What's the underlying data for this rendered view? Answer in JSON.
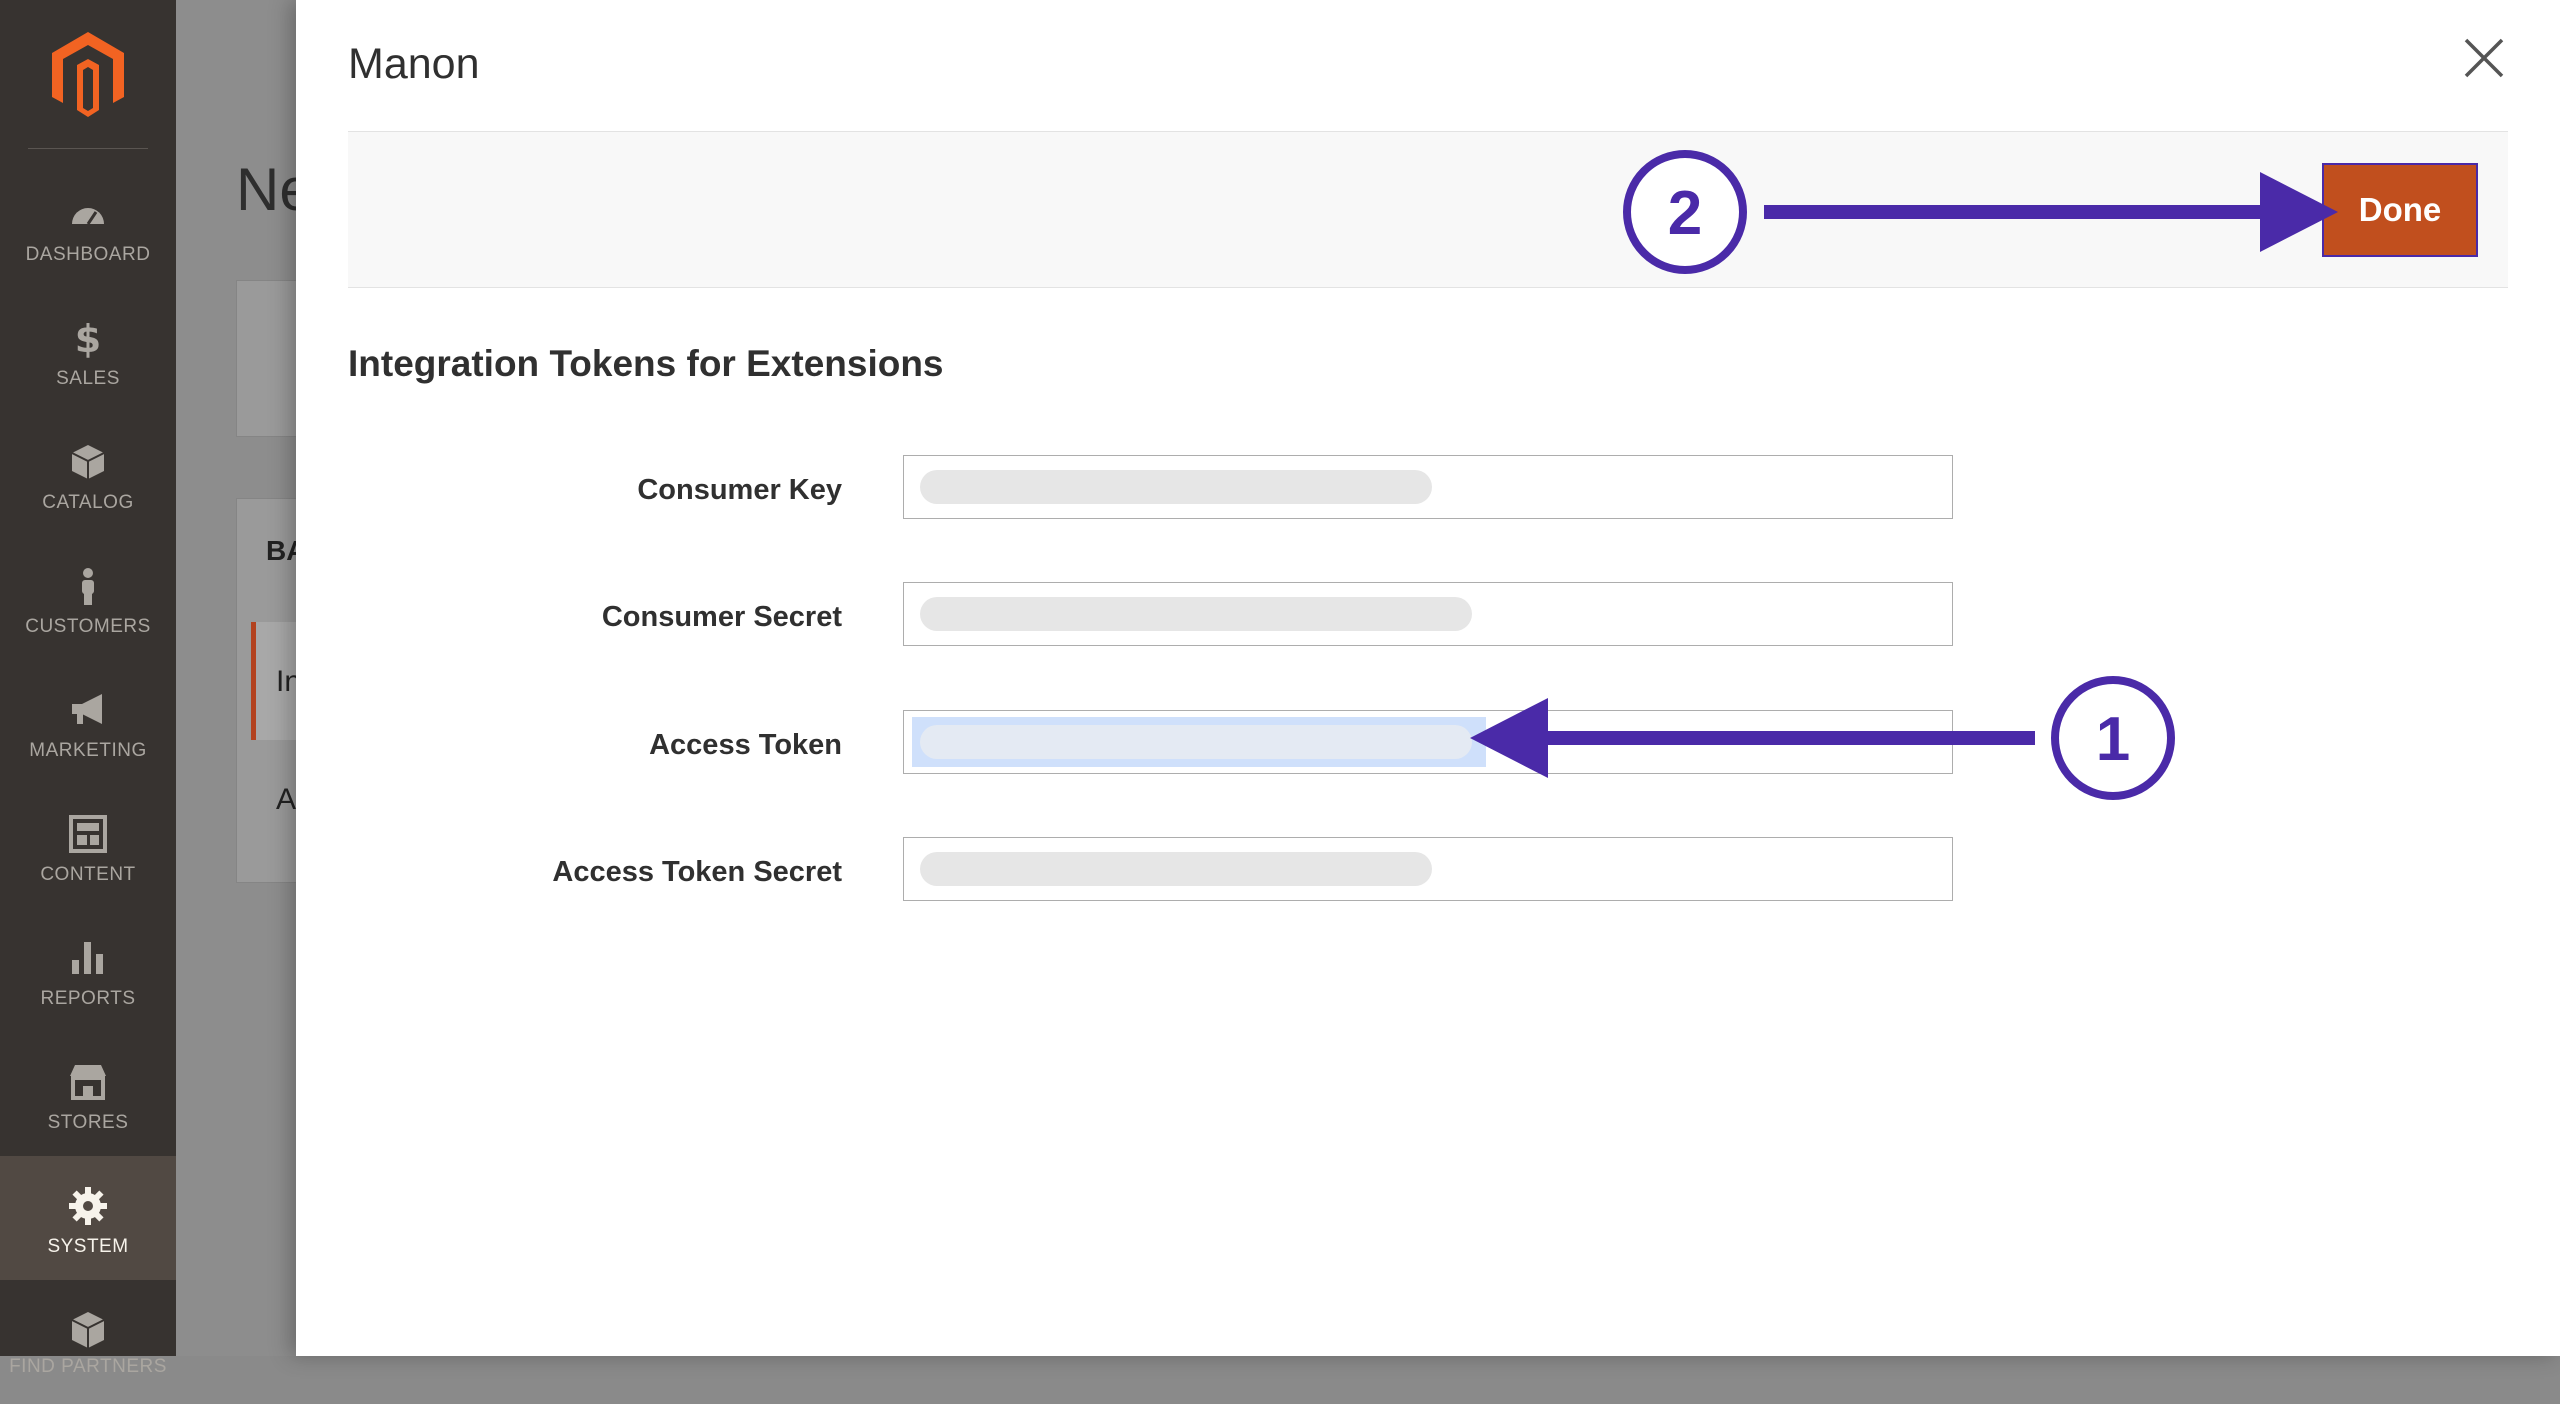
{
  "sidebar": {
    "logo_icon": "magento-logo-icon",
    "items": [
      {
        "label": "DASHBOARD",
        "icon": "dashboard-gauge-icon"
      },
      {
        "label": "SALES",
        "icon": "dollar-icon"
      },
      {
        "label": "CATALOG",
        "icon": "cube-icon"
      },
      {
        "label": "CUSTOMERS",
        "icon": "person-icon"
      },
      {
        "label": "MARKETING",
        "icon": "megaphone-icon"
      },
      {
        "label": "CONTENT",
        "icon": "layout-icon"
      },
      {
        "label": "REPORTS",
        "icon": "bar-chart-icon"
      },
      {
        "label": "STORES",
        "icon": "storefront-icon"
      },
      {
        "label": "SYSTEM",
        "icon": "gear-icon",
        "active": true
      },
      {
        "label": "FIND PARTNERS",
        "icon": "boxes-icon"
      }
    ]
  },
  "background": {
    "title_fragment": "Ne",
    "fragment_1": "BA",
    "fragment_2": "In",
    "fragment_3": "A"
  },
  "modal": {
    "title": "Manon",
    "close_icon": "close-icon",
    "done_label": "Done",
    "section_title": "Integration Tokens for Extensions",
    "fields": [
      {
        "label": "Consumer Key",
        "value_redacted": true
      },
      {
        "label": "Consumer Secret",
        "value_redacted": true
      },
      {
        "label": "Access Token",
        "value_redacted": true,
        "selected": true
      },
      {
        "label": "Access Token Secret",
        "value_redacted": true
      }
    ]
  },
  "annotations": {
    "step_1": "1",
    "step_2": "2",
    "color": "#4a2aa8"
  },
  "colors": {
    "accent": "#c14f1e",
    "sidebar_bg": "#373330",
    "annotation": "#4a2aa8"
  }
}
